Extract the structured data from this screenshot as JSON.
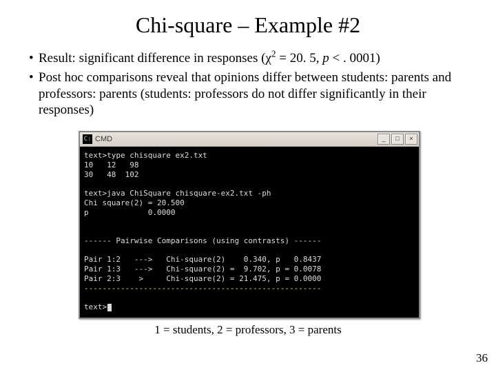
{
  "title": "Chi-square – Example #2",
  "bullets": [
    {
      "pre": "Result: significant difference in responses (",
      "chi": "χ",
      "sup": "2",
      "mid": " = 20. 5, ",
      "p": "p",
      "post": " < . 0001)"
    },
    {
      "text": "Post hoc comparisons reveal that opinions differ between students: parents and professors: parents (students: professors do not differ significantly in their responses)"
    }
  ],
  "terminal": {
    "window_title": "CMD",
    "buttons": {
      "min": "_",
      "max": "□",
      "close": "×"
    },
    "lines": [
      "text>type chisquare ex2.txt",
      "10   12   98",
      "30   48  102",
      "",
      "text>java ChiSquare chisquare-ex2.txt -ph",
      "Chi square(2) = 20.500",
      "p             0.0000",
      "",
      "",
      "------ Pairwise Comparisons (using contrasts) ------",
      "",
      "Pair 1:2   --->   Chi-square(2)    0.340, p   0.8437",
      "Pair 1:3   --->   Chi-square(2) =  9.702, p = 0.0078",
      "Pair 2:3    >     Chi-square(2) = 21.475, p = 0.0000"
    ],
    "dashes": "----------------------------------------------------",
    "prompt": "text>"
  },
  "caption": "1 = students, 2 = professors, 3 = parents",
  "page_number": "36"
}
